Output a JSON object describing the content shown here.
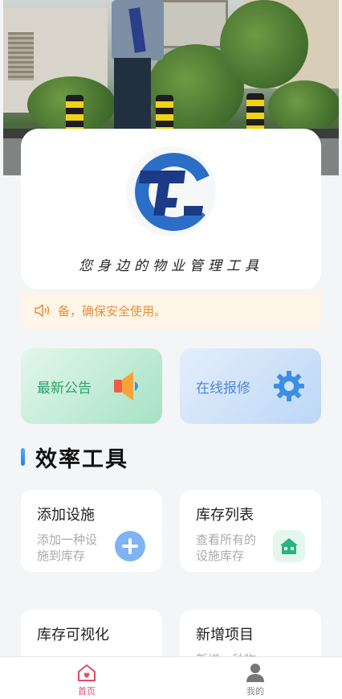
{
  "logo_card": {
    "slogan": "您身边的物业管理工具"
  },
  "notice": {
    "text": "备，确保安全使用。"
  },
  "quick_actions": [
    {
      "label": "最新公告",
      "icon": "megaphone-icon"
    },
    {
      "label": "在线报修",
      "icon": "gear-icon"
    }
  ],
  "section": {
    "title": "效率工具"
  },
  "tools": [
    {
      "title": "添加设施",
      "desc": "添加一种设施到库存",
      "icon": "plus-icon"
    },
    {
      "title": "库存列表",
      "desc": "查看所有的设施库存",
      "icon": "house-icon"
    },
    {
      "title": "库存可视化",
      "desc": "",
      "icon": ""
    },
    {
      "title": "新增项目",
      "desc": "新增一种物",
      "icon": ""
    }
  ],
  "tabbar": {
    "items": [
      {
        "label": "首页",
        "icon": "home-icon",
        "active": true
      },
      {
        "label": "我的",
        "icon": "user-icon",
        "active": false
      }
    ]
  },
  "colors": {
    "accent_green": "#2aa56a",
    "accent_blue": "#4f89d6",
    "notice_orange": "#e8903a",
    "tab_active": "#e5476b"
  }
}
